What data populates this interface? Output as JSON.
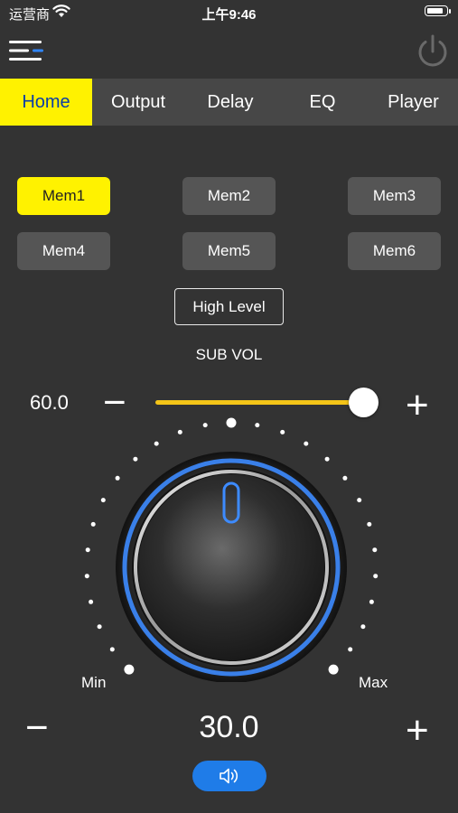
{
  "status_bar": {
    "carrier": "运营商",
    "time": "上午9:46",
    "battery_level": 0.9
  },
  "header": {
    "menu_icon": "menu-icon",
    "power_icon": "power-icon"
  },
  "tabs": [
    {
      "label": "Home",
      "active": true
    },
    {
      "label": "Output",
      "active": false
    },
    {
      "label": "Delay",
      "active": false
    },
    {
      "label": "EQ",
      "active": false
    },
    {
      "label": "Player",
      "active": false
    }
  ],
  "memories": [
    {
      "label": "Mem1",
      "active": true
    },
    {
      "label": "Mem2",
      "active": false
    },
    {
      "label": "Mem3",
      "active": false
    },
    {
      "label": "Mem4",
      "active": false
    },
    {
      "label": "Mem5",
      "active": false
    },
    {
      "label": "Mem6",
      "active": false
    }
  ],
  "input_mode_button": "High Level",
  "sub_vol": {
    "label": "SUB VOL",
    "value": "60.0",
    "minus": "−",
    "plus": "+",
    "level": 0.97
  },
  "main_vol": {
    "min_label": "Min",
    "max_label": "Max",
    "value": "30.0",
    "minus": "−",
    "plus": "+",
    "mute_icon": "speaker-icon"
  },
  "colors": {
    "accent": "#fff200",
    "slider": "#f5c518",
    "knob_glow": "#3d8bff",
    "mute_button": "#1f7ce8",
    "tab_active_text": "#0a3da8"
  }
}
